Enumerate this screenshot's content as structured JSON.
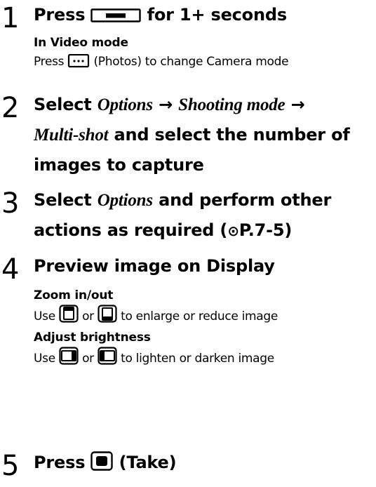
{
  "steps": [
    {
      "num": "1",
      "text_before": "Press",
      "text_after": "for 1+ seconds",
      "sub": {
        "title": "In Video mode",
        "text_before": "Press",
        "text_after": "(Photos) to change Camera mode"
      }
    },
    {
      "num": "2",
      "select": "Select",
      "arrow1": "→",
      "opt1": "Options",
      "opt2": "Shooting mode",
      "arrow2": "→",
      "opt3": "Multi-shot",
      "rest1": "and select the number of",
      "rest2": "images to capture"
    },
    {
      "num": "3",
      "select": "Select",
      "opt1": "Options",
      "rest1": "and perform other",
      "rest2a": "actions as required (",
      "ref_mark": "⊙",
      "ref": "P.7-5)"
    },
    {
      "num": "4",
      "text": "Preview image on Display",
      "sub1": {
        "title": "Zoom in/out",
        "use": "Use",
        "or": "or",
        "rest": "to enlarge or reduce image"
      },
      "sub2": {
        "title": "Adjust brightness",
        "use": "Use",
        "or": "or",
        "rest": "to lighten or darken image"
      }
    },
    {
      "num": "5",
      "text_before": "Press",
      "text_after": "(Take)"
    }
  ],
  "icons": {
    "side_key": "side-camera-key-icon",
    "photos": "photos-softkey-icon",
    "nav_up": "nav-key-up-icon",
    "nav_down": "nav-key-down-icon",
    "nav_left": "nav-key-left-icon",
    "nav_right": "nav-key-right-icon",
    "center": "center-key-icon"
  }
}
